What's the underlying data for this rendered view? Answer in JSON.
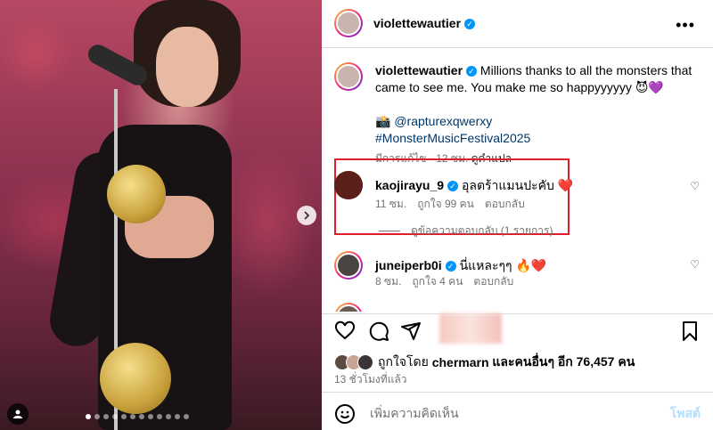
{
  "post": {
    "username": "violettewautier",
    "more_icon": "more-horizontal-icon",
    "photo_alt": "Performer on stage with microphone stand",
    "carousel_count": 12,
    "carousel_index": 0
  },
  "caption": {
    "username": "violettewautier",
    "text": "Millions thanks to all the monsters that came to see me. You make me so happyyyyyy 😈💜",
    "line2_emoji": "📸",
    "mention": "@rapturexqwerxy",
    "hashtag": "#MonsterMusicFestival2025",
    "edited": "มีการแก้ไข · 12 ซม.",
    "translate": "ดูคำแปล"
  },
  "comments": [
    {
      "username": "kaojirayu_9",
      "text": "อุลตร้าแมนปะคับ",
      "emoji": "❤️",
      "time": "11 ซม.",
      "likes": "ถูกใจ 99 คน",
      "reply": "ตอบกลับ",
      "view_replies": "ดูข้อความตอบกลับ (1 รายการ)"
    },
    {
      "username": "juneiperb0i",
      "text": "นี่แหละๆๆ",
      "emoji": "🔥❤️",
      "time": "8 ซม.",
      "likes": "ถูกใจ 4 คน",
      "reply": "ตอบกลับ"
    }
  ],
  "likes": {
    "prefix": "ถูกใจโดย",
    "user": "chermarn",
    "suffix": "และคนอื่นๆ อีก 76,457 คน"
  },
  "time_ago": "13 ชั่วโมงที่แล้ว",
  "add_comment": {
    "placeholder": "เพิ่มความคิดเห็น",
    "post": "โพสต์"
  },
  "colors": {
    "verified": "#0095f6",
    "highlight": "#e11d2a",
    "link": "#00376b"
  }
}
